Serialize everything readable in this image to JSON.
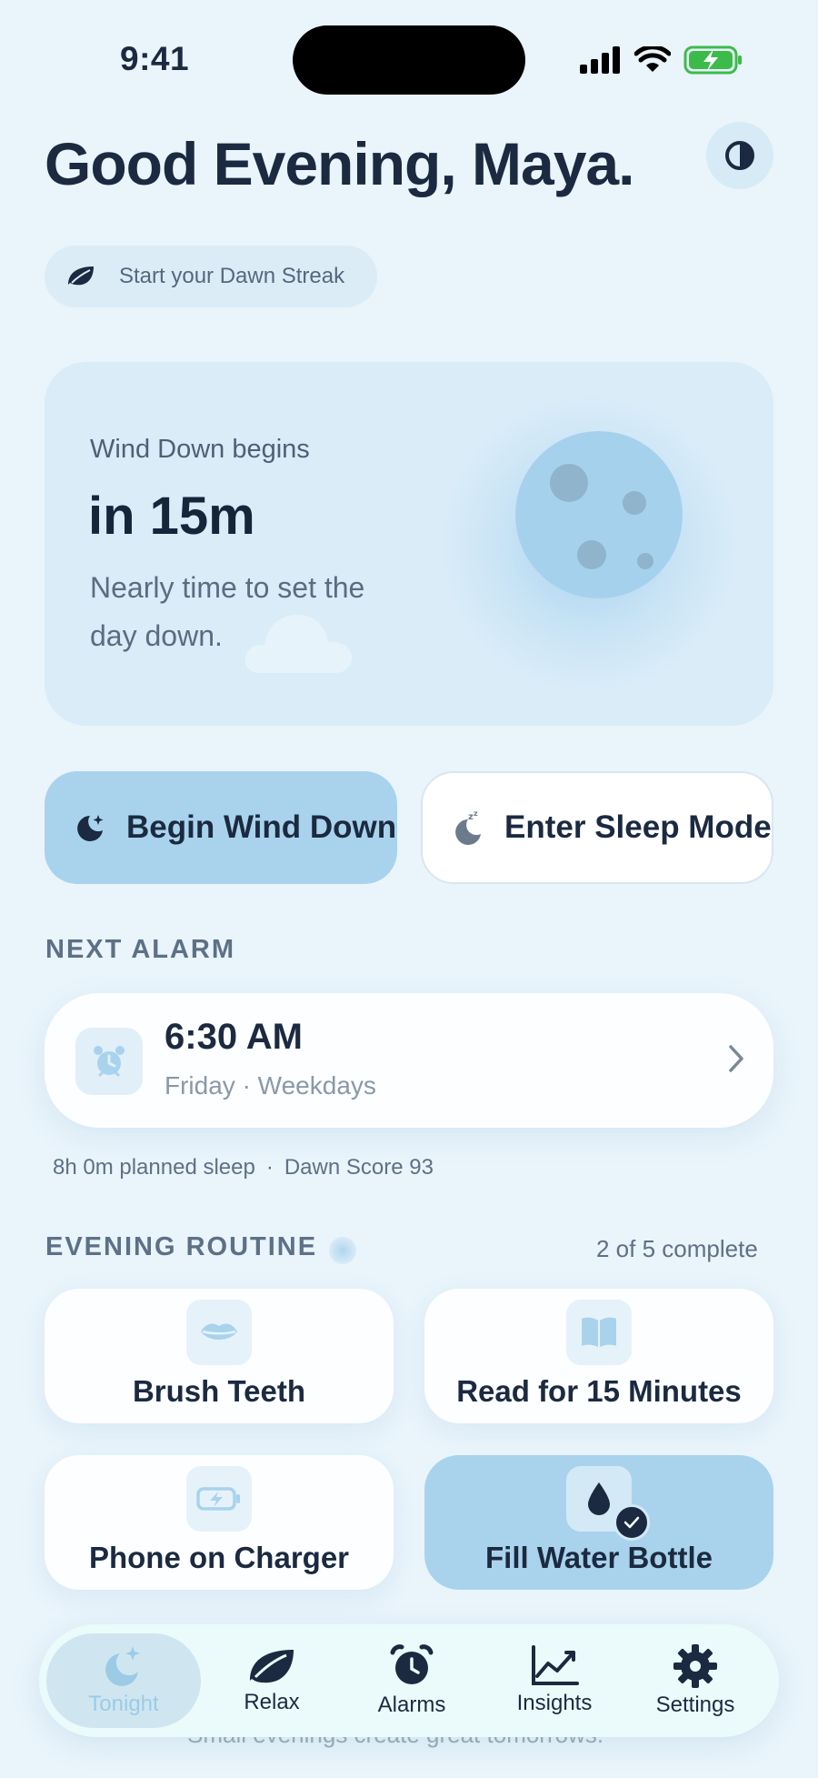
{
  "status_bar": {
    "time": "9:41"
  },
  "header": {
    "greeting": "Good Evening, Maya.",
    "theme_icon": "contrast-icon"
  },
  "streak": {
    "label": "Start your Dawn Streak",
    "icon": "leaf-icon"
  },
  "wind_down_card": {
    "subtitle": "Wind Down begins",
    "countdown": "in 15m",
    "description": "Nearly time to set the day down."
  },
  "actions": {
    "begin_label": "Begin Wind Down",
    "sleep_label": "Enter Sleep Mode"
  },
  "next_alarm": {
    "section_title": "NEXT ALARM",
    "time": "6:30 AM",
    "days": "Friday · Weekdays",
    "planned_sleep": "8h 0m planned sleep",
    "separator": "·",
    "score": "Dawn Score 93"
  },
  "routine": {
    "section_title": "EVENING ROUTINE",
    "progress": "2 of 5 complete",
    "items": [
      {
        "label": "Brush Teeth",
        "icon": "lips-icon",
        "done": false
      },
      {
        "label": "Read for 15 Minutes",
        "icon": "book-icon",
        "done": false
      },
      {
        "label": "Phone on Charger",
        "icon": "battery-charging-icon",
        "done": false
      },
      {
        "label": "Fill Water Bottle",
        "icon": "water-drop-icon",
        "done": true
      }
    ]
  },
  "footer_text": "Small evenings create great tomorrows.",
  "tabs": [
    {
      "label": "Tonight",
      "icon": "moon-stars-icon",
      "active": true
    },
    {
      "label": "Relax",
      "icon": "leaf-icon",
      "active": false
    },
    {
      "label": "Alarms",
      "icon": "alarm-clock-icon",
      "active": false
    },
    {
      "label": "Insights",
      "icon": "chart-line-icon",
      "active": false
    },
    {
      "label": "Settings",
      "icon": "gear-icon",
      "active": false
    }
  ],
  "colors": {
    "background": "#e9f4fb",
    "accent": "#a9d3ec",
    "text_primary": "#1b2a40",
    "battery_green": "#3dbb4a"
  }
}
